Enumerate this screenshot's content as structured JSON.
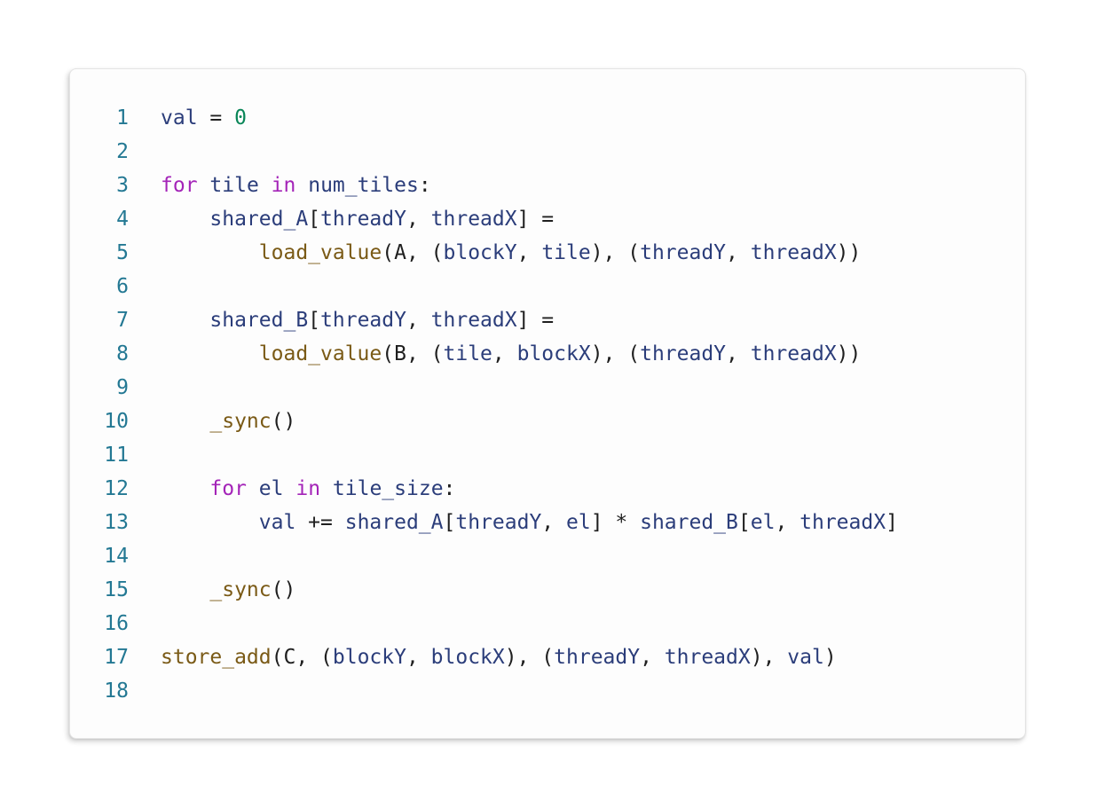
{
  "editor": {
    "lines": [
      {
        "number": "1",
        "tokens": [
          {
            "t": "val",
            "c": "var"
          },
          {
            "t": " = ",
            "c": "op"
          },
          {
            "t": "0",
            "c": "num"
          }
        ]
      },
      {
        "number": "2",
        "tokens": []
      },
      {
        "number": "3",
        "tokens": [
          {
            "t": "for",
            "c": "kw"
          },
          {
            "t": " ",
            "c": "op"
          },
          {
            "t": "tile",
            "c": "var"
          },
          {
            "t": " ",
            "c": "op"
          },
          {
            "t": "in",
            "c": "kw"
          },
          {
            "t": " ",
            "c": "op"
          },
          {
            "t": "num_tiles",
            "c": "var"
          },
          {
            "t": ":",
            "c": "op"
          }
        ]
      },
      {
        "number": "4",
        "tokens": [
          {
            "t": "    ",
            "c": "op"
          },
          {
            "t": "shared_A",
            "c": "var"
          },
          {
            "t": "[",
            "c": "op"
          },
          {
            "t": "threadY",
            "c": "var"
          },
          {
            "t": ", ",
            "c": "op"
          },
          {
            "t": "threadX",
            "c": "var"
          },
          {
            "t": "] =",
            "c": "op"
          }
        ]
      },
      {
        "number": "5",
        "tokens": [
          {
            "t": "        ",
            "c": "op"
          },
          {
            "t": "load_value",
            "c": "fn"
          },
          {
            "t": "(A, (",
            "c": "op"
          },
          {
            "t": "blockY",
            "c": "var"
          },
          {
            "t": ", ",
            "c": "op"
          },
          {
            "t": "tile",
            "c": "var"
          },
          {
            "t": "), (",
            "c": "op"
          },
          {
            "t": "threadY",
            "c": "var"
          },
          {
            "t": ", ",
            "c": "op"
          },
          {
            "t": "threadX",
            "c": "var"
          },
          {
            "t": "))",
            "c": "op"
          }
        ]
      },
      {
        "number": "6",
        "tokens": []
      },
      {
        "number": "7",
        "tokens": [
          {
            "t": "    ",
            "c": "op"
          },
          {
            "t": "shared_B",
            "c": "var"
          },
          {
            "t": "[",
            "c": "op"
          },
          {
            "t": "threadY",
            "c": "var"
          },
          {
            "t": ", ",
            "c": "op"
          },
          {
            "t": "threadX",
            "c": "var"
          },
          {
            "t": "] =",
            "c": "op"
          }
        ]
      },
      {
        "number": "8",
        "tokens": [
          {
            "t": "        ",
            "c": "op"
          },
          {
            "t": "load_value",
            "c": "fn"
          },
          {
            "t": "(B, (",
            "c": "op"
          },
          {
            "t": "tile",
            "c": "var"
          },
          {
            "t": ", ",
            "c": "op"
          },
          {
            "t": "blockX",
            "c": "var"
          },
          {
            "t": "), (",
            "c": "op"
          },
          {
            "t": "threadY",
            "c": "var"
          },
          {
            "t": ", ",
            "c": "op"
          },
          {
            "t": "threadX",
            "c": "var"
          },
          {
            "t": "))",
            "c": "op"
          }
        ]
      },
      {
        "number": "9",
        "tokens": []
      },
      {
        "number": "10",
        "tokens": [
          {
            "t": "    ",
            "c": "op"
          },
          {
            "t": "_sync",
            "c": "fn"
          },
          {
            "t": "()",
            "c": "op"
          }
        ]
      },
      {
        "number": "11",
        "tokens": []
      },
      {
        "number": "12",
        "tokens": [
          {
            "t": "    ",
            "c": "op"
          },
          {
            "t": "for",
            "c": "kw"
          },
          {
            "t": " ",
            "c": "op"
          },
          {
            "t": "el",
            "c": "var"
          },
          {
            "t": " ",
            "c": "op"
          },
          {
            "t": "in",
            "c": "kw"
          },
          {
            "t": " ",
            "c": "op"
          },
          {
            "t": "tile_size",
            "c": "var"
          },
          {
            "t": ":",
            "c": "op"
          }
        ]
      },
      {
        "number": "13",
        "tokens": [
          {
            "t": "        ",
            "c": "op"
          },
          {
            "t": "val",
            "c": "var"
          },
          {
            "t": " += ",
            "c": "op"
          },
          {
            "t": "shared_A",
            "c": "var"
          },
          {
            "t": "[",
            "c": "op"
          },
          {
            "t": "threadY",
            "c": "var"
          },
          {
            "t": ", ",
            "c": "op"
          },
          {
            "t": "el",
            "c": "var"
          },
          {
            "t": "] * ",
            "c": "op"
          },
          {
            "t": "shared_B",
            "c": "var"
          },
          {
            "t": "[",
            "c": "op"
          },
          {
            "t": "el",
            "c": "var"
          },
          {
            "t": ", ",
            "c": "op"
          },
          {
            "t": "threadX",
            "c": "var"
          },
          {
            "t": "]",
            "c": "op"
          }
        ]
      },
      {
        "number": "14",
        "tokens": []
      },
      {
        "number": "15",
        "tokens": [
          {
            "t": "    ",
            "c": "op"
          },
          {
            "t": "_sync",
            "c": "fn"
          },
          {
            "t": "()",
            "c": "op"
          }
        ]
      },
      {
        "number": "16",
        "tokens": []
      },
      {
        "number": "17",
        "tokens": [
          {
            "t": "store_add",
            "c": "fn"
          },
          {
            "t": "(C, (",
            "c": "op"
          },
          {
            "t": "blockY",
            "c": "var"
          },
          {
            "t": ", ",
            "c": "op"
          },
          {
            "t": "blockX",
            "c": "var"
          },
          {
            "t": "), (",
            "c": "op"
          },
          {
            "t": "threadY",
            "c": "var"
          },
          {
            "t": ", ",
            "c": "op"
          },
          {
            "t": "threadX",
            "c": "var"
          },
          {
            "t": "), ",
            "c": "op"
          },
          {
            "t": "val",
            "c": "var"
          },
          {
            "t": ")",
            "c": "op"
          }
        ]
      },
      {
        "number": "18",
        "tokens": []
      }
    ]
  },
  "colors": {
    "line_number": "#237893",
    "variable": "#2b3d7a",
    "keyword": "#a424b8",
    "function": "#7a5a16",
    "number": "#098658",
    "punctuation": "#1f1f1f"
  }
}
